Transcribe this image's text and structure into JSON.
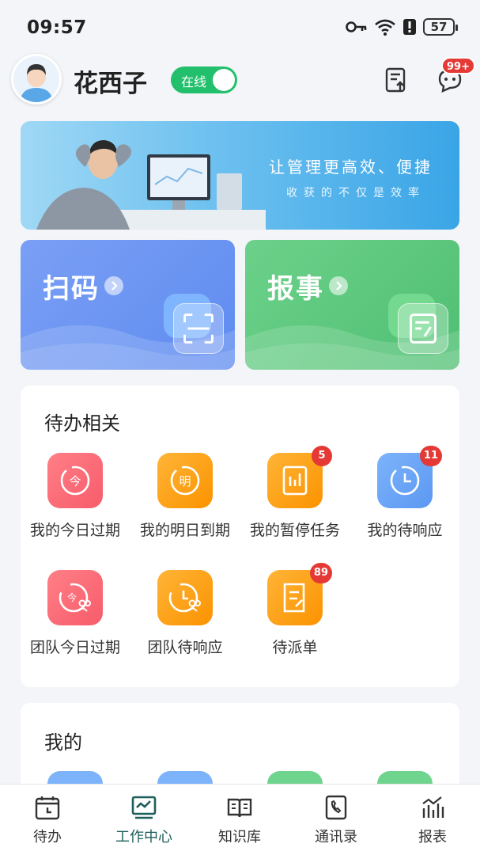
{
  "status_bar": {
    "time": "09:57",
    "battery": "57"
  },
  "header": {
    "user_name": "花西子",
    "online_label": "在线",
    "message_badge": "99+"
  },
  "banner": {
    "line1": "让管理更高效、便捷",
    "line2": "收获的不仅是效率"
  },
  "actions": {
    "scan_label": "扫码",
    "report_label": "报事"
  },
  "todo": {
    "title": "待办相关",
    "items": [
      {
        "label": "我的今日过期",
        "glyph": "今",
        "color": "red"
      },
      {
        "label": "我的明日到期",
        "glyph": "明",
        "color": "orange"
      },
      {
        "label": "我的暂停任务",
        "badge": "5",
        "color": "orange"
      },
      {
        "label": "我的待响应",
        "badge": "11",
        "color": "blue"
      },
      {
        "label": "团队今日过期",
        "glyph": "今",
        "color": "red"
      },
      {
        "label": "团队待响应",
        "color": "orange"
      },
      {
        "label": "待派单",
        "badge": "89",
        "color": "orange"
      }
    ]
  },
  "mine": {
    "title": "我的"
  },
  "nav": {
    "items": [
      {
        "label": "待办"
      },
      {
        "label": "工作中心"
      },
      {
        "label": "知识库"
      },
      {
        "label": "通讯录"
      },
      {
        "label": "报表"
      }
    ],
    "active_index": 1
  },
  "colors": {
    "online_green": "#22c06c",
    "badge_red": "#e53935",
    "scan_blue": "#5f8cf0",
    "report_green": "#4fbf72",
    "tile_red": "#f75c6a",
    "tile_orange": "#fb9300",
    "tile_blue": "#5b98f2",
    "nav_active": "#1f5f5b"
  }
}
